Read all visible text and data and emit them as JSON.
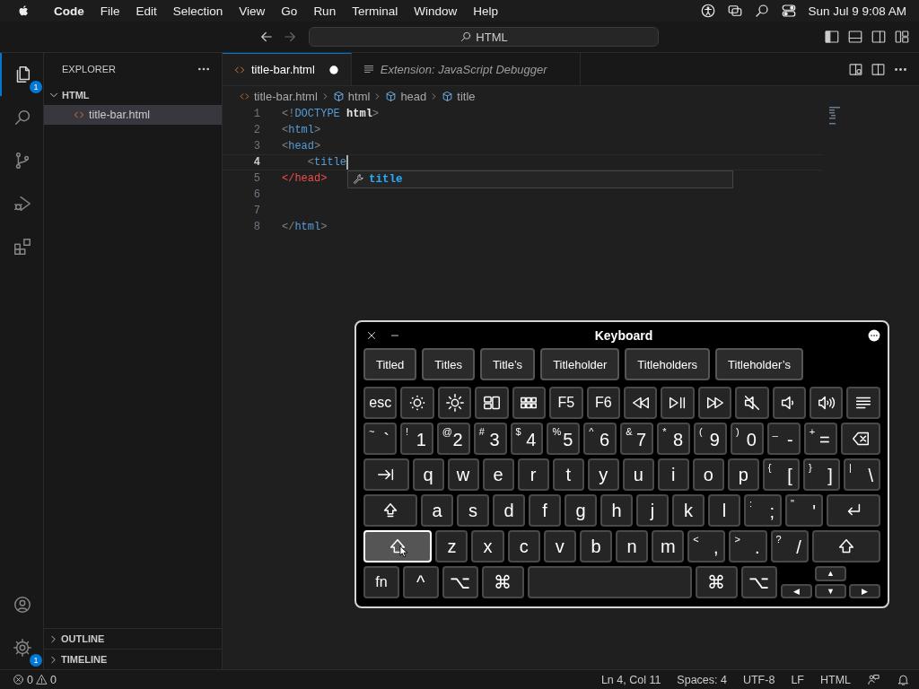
{
  "menu_bar": {
    "app": "Code",
    "menus": [
      "File",
      "Edit",
      "Selection",
      "View",
      "Go",
      "Run",
      "Terminal",
      "Window",
      "Help"
    ],
    "clock": "Sun Jul 9  9:08 AM"
  },
  "title_bar": {
    "nav": [
      {
        "kind": "back",
        "disabled": false
      },
      {
        "kind": "forward",
        "disabled": true
      }
    ],
    "search": "HTML"
  },
  "activity_bar": {
    "items": [
      {
        "kind": "files",
        "selected": true,
        "badge": "1"
      },
      {
        "kind": "search",
        "selected": false
      },
      {
        "kind": "branch",
        "selected": false
      },
      {
        "kind": "run",
        "selected": false
      },
      {
        "kind": "blocks",
        "selected": false
      }
    ],
    "bottom": [
      {
        "kind": "account",
        "selected": false
      },
      {
        "kind": "settings",
        "selected": false,
        "badge": "1"
      }
    ]
  },
  "sidebar": {
    "title": "EXPLORER",
    "tree": [
      {
        "label": "HTML",
        "kind": "folder",
        "expanded": true,
        "selected": false,
        "children": [
          {
            "label": "title-bar.html",
            "kind": "file",
            "selected": true
          }
        ]
      }
    ],
    "sections": [
      {
        "label": "OUTLINE",
        "expanded": false
      },
      {
        "label": "TIMELINE",
        "expanded": false
      }
    ]
  },
  "tabs": [
    {
      "label": "title-bar.html",
      "kind": "file",
      "selected": true,
      "dirty": true
    },
    {
      "label": "Extension: JavaScript Debugger",
      "kind": "preview",
      "selected": false,
      "dirty": false
    }
  ],
  "breadcrumbs": [
    {
      "label": "title-bar.html",
      "kind": "file"
    },
    {
      "label": "html",
      "kind": "element"
    },
    {
      "label": "head",
      "kind": "element"
    },
    {
      "label": "title",
      "kind": "element"
    }
  ],
  "editor": {
    "lines": [
      {
        "number": "1",
        "current": false,
        "tokens": [
          {
            "text": "<!",
            "kind": "punct"
          },
          {
            "text": "DOCTYPE",
            "kind": "tag"
          },
          {
            "text": " html",
            "kind": "attr"
          },
          {
            "text": ">",
            "kind": "punct"
          }
        ]
      },
      {
        "number": "2",
        "current": false,
        "tokens": [
          {
            "text": "<",
            "kind": "punct"
          },
          {
            "text": "html",
            "kind": "tag"
          },
          {
            "text": ">",
            "kind": "punct"
          }
        ]
      },
      {
        "number": "3",
        "current": false,
        "tokens": [
          {
            "text": "<",
            "kind": "punct"
          },
          {
            "text": "head",
            "kind": "tag"
          },
          {
            "text": ">",
            "kind": "punct"
          }
        ]
      },
      {
        "number": "4",
        "current": true,
        "tokens": [
          {
            "text": "    <",
            "kind": "punct"
          },
          {
            "text": "title",
            "kind": "tag"
          }
        ]
      },
      {
        "number": "5",
        "current": false,
        "tokens": [
          {
            "text": "</head>",
            "kind": "error"
          }
        ]
      },
      {
        "number": "6",
        "current": false
      },
      {
        "number": "7",
        "current": false
      },
      {
        "number": "8",
        "current": false,
        "tokens": [
          {
            "text": "</",
            "kind": "punct"
          },
          {
            "text": "html",
            "kind": "tag"
          },
          {
            "text": ">",
            "kind": "punct"
          }
        ]
      }
    ],
    "suggestion": {
      "label": "title"
    }
  },
  "keyboard": {
    "title": "Keyboard",
    "suggestions": [
      "Titled",
      "Titles",
      "Title’s",
      "Titleholder",
      "Titleholders",
      "Titleholder’s"
    ],
    "rows": [
      {
        "keys": [
          {
            "kind": "char",
            "label": "esc",
            "pressed": false
          },
          {
            "kind": "brightness-down",
            "pressed": false
          },
          {
            "kind": "brightness-up",
            "pressed": false
          },
          {
            "kind": "mission-control",
            "pressed": false
          },
          {
            "kind": "launchpad",
            "pressed": false
          },
          {
            "kind": "char",
            "label": "F5",
            "pressed": false
          },
          {
            "kind": "char",
            "label": "F6",
            "pressed": false
          },
          {
            "kind": "rewind",
            "pressed": false
          },
          {
            "kind": "play-pause",
            "pressed": false
          },
          {
            "kind": "fast-forward",
            "pressed": false
          },
          {
            "kind": "mute",
            "pressed": false
          },
          {
            "kind": "volume-down",
            "pressed": false
          },
          {
            "kind": "volume-up",
            "pressed": false
          },
          {
            "kind": "list",
            "pressed": false
          }
        ]
      },
      {
        "keys": [
          {
            "kind": "dual",
            "shift": "~",
            "label": "`",
            "pressed": false
          },
          {
            "kind": "dual",
            "shift": "!",
            "label": "1",
            "pressed": false
          },
          {
            "kind": "dual",
            "shift": "@",
            "label": "2",
            "pressed": false
          },
          {
            "kind": "dual",
            "shift": "#",
            "label": "3",
            "pressed": false
          },
          {
            "kind": "dual",
            "shift": "$",
            "label": "4",
            "pressed": false
          },
          {
            "kind": "dual",
            "shift": "%",
            "label": "5",
            "pressed": false
          },
          {
            "kind": "dual",
            "shift": "^",
            "label": "6",
            "pressed": false
          },
          {
            "kind": "dual",
            "shift": "&",
            "label": "7",
            "pressed": false
          },
          {
            "kind": "dual",
            "shift": "*",
            "label": "8",
            "pressed": false
          },
          {
            "kind": "dual",
            "shift": "(",
            "label": "9",
            "pressed": false
          },
          {
            "kind": "dual",
            "shift": ")",
            "label": "0",
            "pressed": false
          },
          {
            "kind": "dual",
            "shift": "_",
            "label": "-",
            "pressed": false
          },
          {
            "kind": "dual",
            "shift": "+",
            "label": "=",
            "pressed": false
          },
          {
            "kind": "delete",
            "pressed": false
          }
        ]
      },
      {
        "keys": [
          {
            "kind": "tab",
            "pressed": false
          },
          {
            "kind": "char",
            "label": "q",
            "pressed": false
          },
          {
            "kind": "char",
            "label": "w",
            "pressed": false
          },
          {
            "kind": "char",
            "label": "e",
            "pressed": false
          },
          {
            "kind": "char",
            "label": "r",
            "pressed": false
          },
          {
            "kind": "char",
            "label": "t",
            "pressed": false
          },
          {
            "kind": "char",
            "label": "y",
            "pressed": false
          },
          {
            "kind": "char",
            "label": "u",
            "pressed": false
          },
          {
            "kind": "char",
            "label": "i",
            "pressed": false
          },
          {
            "kind": "char",
            "label": "o",
            "pressed": false
          },
          {
            "kind": "char",
            "label": "p",
            "pressed": false
          },
          {
            "kind": "dual",
            "shift": "{",
            "label": "[",
            "pressed": false
          },
          {
            "kind": "dual",
            "shift": "}",
            "label": "]",
            "pressed": false
          },
          {
            "kind": "dual",
            "shift": "|",
            "label": "\\",
            "pressed": false
          }
        ]
      },
      {
        "keys": [
          {
            "kind": "caps-lock",
            "pressed": false
          },
          {
            "kind": "char",
            "label": "a",
            "pressed": false
          },
          {
            "kind": "char",
            "label": "s",
            "pressed": false
          },
          {
            "kind": "char",
            "label": "d",
            "pressed": false
          },
          {
            "kind": "char",
            "label": "f",
            "pressed": false
          },
          {
            "kind": "char",
            "label": "g",
            "pressed": false
          },
          {
            "kind": "char",
            "label": "h",
            "pressed": false
          },
          {
            "kind": "char",
            "label": "j",
            "pressed": false
          },
          {
            "kind": "char",
            "label": "k",
            "pressed": false
          },
          {
            "kind": "char",
            "label": "l",
            "pressed": false
          },
          {
            "kind": "dual",
            "shift": ":",
            "label": ";",
            "pressed": false
          },
          {
            "kind": "dual",
            "shift": "\"",
            "label": "'",
            "pressed": false
          },
          {
            "kind": "return",
            "pressed": false
          }
        ]
      },
      {
        "keys": [
          {
            "kind": "shift",
            "pressed": true
          },
          {
            "kind": "char",
            "label": "z",
            "pressed": false
          },
          {
            "kind": "char",
            "label": "x",
            "pressed": false
          },
          {
            "kind": "char",
            "label": "c",
            "pressed": false
          },
          {
            "kind": "char",
            "label": "v",
            "pressed": false
          },
          {
            "kind": "char",
            "label": "b",
            "pressed": false
          },
          {
            "kind": "char",
            "label": "n",
            "pressed": false
          },
          {
            "kind": "char",
            "label": "m",
            "pressed": false
          },
          {
            "kind": "dual",
            "shift": "<",
            "label": ",",
            "pressed": false
          },
          {
            "kind": "dual",
            "shift": ">",
            "label": ".",
            "pressed": false
          },
          {
            "kind": "dual",
            "shift": "?",
            "label": "/",
            "pressed": false
          },
          {
            "kind": "shift",
            "pressed": false
          }
        ]
      },
      {
        "keys": [
          {
            "kind": "char",
            "label": "fn",
            "pressed": false
          },
          {
            "kind": "char",
            "label": "^",
            "pressed": false
          },
          {
            "kind": "char",
            "label": "⌥",
            "pressed": false
          },
          {
            "kind": "cmd",
            "label": "⌘",
            "pressed": false
          },
          {
            "kind": "space",
            "pressed": false
          },
          {
            "kind": "cmd",
            "label": "⌘",
            "pressed": false
          },
          {
            "kind": "char",
            "label": "⌥",
            "pressed": false
          },
          {
            "kind": "arrows",
            "keys": [
              {
                "label": "▲",
                "pressed": false
              },
              {
                "label": "◀",
                "pressed": false
              },
              {
                "label": "▼",
                "pressed": false
              },
              {
                "label": "▶",
                "pressed": false
              }
            ]
          }
        ]
      }
    ]
  },
  "status_bar": {
    "errors": "0",
    "warnings": "0",
    "items": [
      "Ln 4, Col 11",
      "Spaces: 4",
      "UTF-8",
      "LF",
      "HTML"
    ]
  }
}
